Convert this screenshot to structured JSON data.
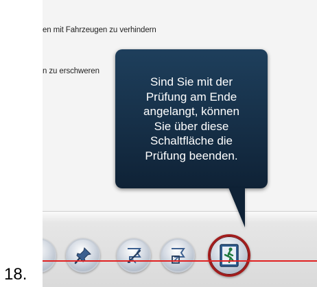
{
  "content": {
    "line1": "en mit Fahrzeugen zu verhindern",
    "line2": "n zu erschweren"
  },
  "tooltip": {
    "text": "Sind Sie mit der\nPrüfung am Ende\nangelangt, können\nSie über diese\nSchaltfläche die\nPrüfung beenden."
  },
  "toolbar": {
    "buttons": [
      {
        "icon": "partial-button-icon"
      },
      {
        "icon": "pin-icon"
      },
      {
        "icon": "flag-crossed-icon"
      },
      {
        "icon": "flag-edit-icon"
      },
      {
        "icon": "exit-door-icon"
      }
    ],
    "exit_highlight_color": "#a31b1b"
  },
  "step": {
    "number": "18."
  },
  "colors": {
    "tooltip_bg": "#1e3f5c",
    "red_line": "#e02020"
  }
}
